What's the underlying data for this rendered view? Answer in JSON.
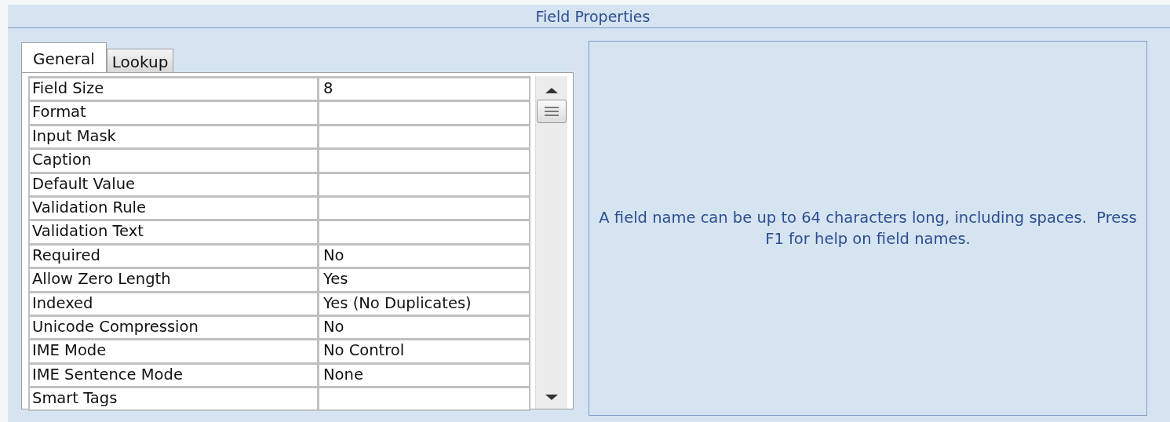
{
  "panel": {
    "title": "Field Properties"
  },
  "tabs": [
    {
      "label": "General",
      "selected": true
    },
    {
      "label": "Lookup",
      "selected": false
    }
  ],
  "properties": [
    {
      "name": "Field Size",
      "value": "8"
    },
    {
      "name": "Format"
    },
    {
      "name": "Input Mask"
    },
    {
      "name": "Caption"
    },
    {
      "name": "Default Value"
    },
    {
      "name": "Validation Rule"
    },
    {
      "name": "Validation Text"
    },
    {
      "name": "Required",
      "value": "No"
    },
    {
      "name": "Allow Zero Length",
      "value": "Yes"
    },
    {
      "name": "Indexed",
      "value": "Yes (No Duplicates)"
    },
    {
      "name": "Unicode Compression",
      "value": "No"
    },
    {
      "name": "IME Mode",
      "value": "No Control"
    },
    {
      "name": "IME Sentence Mode",
      "value": "None"
    },
    {
      "name": "Smart Tags"
    }
  ],
  "help": {
    "text": "A field name can be up to 64 characters long, including spaces.  Press F1 for help on field names."
  }
}
